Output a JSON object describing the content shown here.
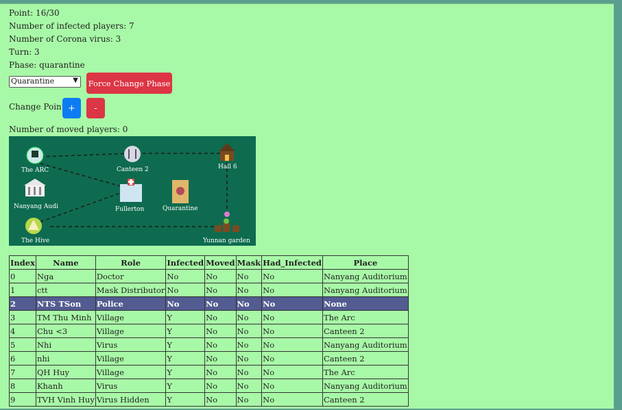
{
  "status": {
    "point": "Point: 16/30",
    "infected": "Number of infected players: 7",
    "corona": "Number of Corona virus: 3",
    "turn": "Turn: 3",
    "phase": "Phase: quarantine"
  },
  "controls": {
    "phase_select_value": "Quarantine",
    "force_label": "Force Change Phase",
    "change_point_label": "Change Point:",
    "plus_label": "+",
    "minus_label": "-",
    "moved": "Number of moved players: 0"
  },
  "map": {
    "places": {
      "arc": "The ARC",
      "canteen": "Canteen 2",
      "hall": "Hall 6",
      "nanyang": "Nanyang Audi",
      "fullerton": "Fullerton",
      "quarantine": "Quarantine",
      "hive": "The Hive",
      "yunnan": "Yunnan garden"
    },
    "colors": {
      "background": "#0e6b4f",
      "path": "#1b1b1b",
      "label": "#ffffff"
    }
  },
  "table": {
    "headers": [
      "Index",
      "Name",
      "Role",
      "Infected",
      "Moved",
      "Mask",
      "Had_Infected",
      "Place"
    ],
    "rows": [
      [
        "0",
        "Nga",
        "Doctor",
        "No",
        "No",
        "No",
        "No",
        "Nanyang Auditorium"
      ],
      [
        "1",
        "ctt",
        "Mask Distributor",
        "No",
        "No",
        "No",
        "No",
        "Nanyang Auditorium"
      ],
      [
        "2",
        "NTS TSon",
        "Police",
        "No",
        "No",
        "No",
        "No",
        "None"
      ],
      [
        "3",
        "TM Thu Minh",
        "Village",
        "Y",
        "No",
        "No",
        "No",
        "The Arc"
      ],
      [
        "4",
        "Chu <3",
        "Village",
        "Y",
        "No",
        "No",
        "No",
        "Canteen 2"
      ],
      [
        "5",
        "Nhi",
        "Virus",
        "Y",
        "No",
        "No",
        "No",
        "Nanyang Auditorium"
      ],
      [
        "6",
        "nhi",
        "Village",
        "Y",
        "No",
        "No",
        "No",
        "Canteen 2"
      ],
      [
        "7",
        "QH Huy",
        "Village",
        "Y",
        "No",
        "No",
        "No",
        "The Arc"
      ],
      [
        "8",
        "Khanh",
        "Virus",
        "Y",
        "No",
        "No",
        "No",
        "Nanyang Auditorium"
      ],
      [
        "9",
        "TVH Vinh Huy",
        "Virus Hidden",
        "Y",
        "No",
        "No",
        "No",
        "Canteen 2"
      ]
    ]
  }
}
